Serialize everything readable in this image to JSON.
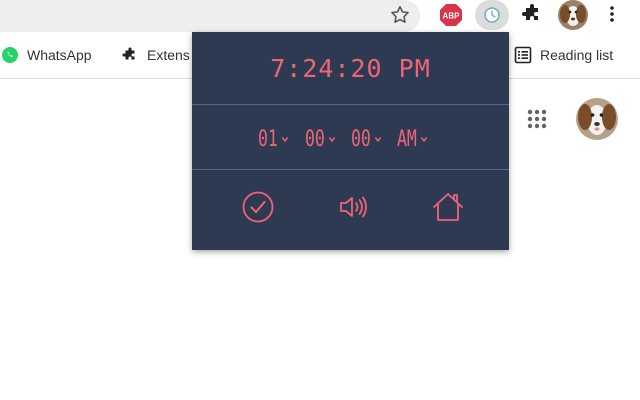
{
  "toolbar": {
    "extension_badge": "ABP"
  },
  "bookmarks": [
    {
      "label": "WhatsApp",
      "icon": "whatsapp-icon"
    },
    {
      "label": "Extens",
      "icon": "puzzle-icon"
    },
    {
      "label": "Reading list",
      "icon": "reading-list-icon"
    }
  ],
  "popup": {
    "current_time": "7:24:20 PM",
    "alarm": {
      "hour": "01",
      "minute": "00",
      "second": "00",
      "ampm": "AM"
    },
    "actions": [
      "check-icon",
      "speaker-icon",
      "home-icon"
    ],
    "accent_color": "#f06478",
    "background_color": "#2d3a52"
  }
}
